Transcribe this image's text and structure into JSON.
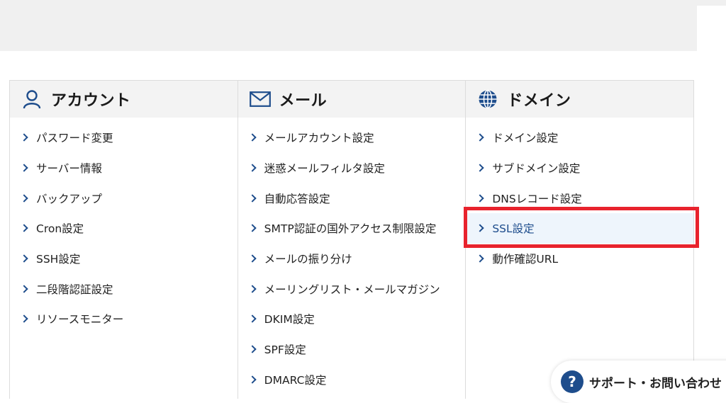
{
  "columns": [
    {
      "title": "アカウント",
      "icon": "user-icon",
      "items": [
        {
          "label": "パスワード変更"
        },
        {
          "label": "サーバー情報"
        },
        {
          "label": "バックアップ"
        },
        {
          "label": "Cron設定"
        },
        {
          "label": "SSH設定"
        },
        {
          "label": "二段階認証設定"
        },
        {
          "label": "リソースモニター"
        }
      ]
    },
    {
      "title": "メール",
      "icon": "mail-icon",
      "items": [
        {
          "label": "メールアカウント設定"
        },
        {
          "label": "迷惑メールフィルタ設定"
        },
        {
          "label": "自動応答設定"
        },
        {
          "label": "SMTP認証の国外アクセス制限設定"
        },
        {
          "label": "メールの振り分け"
        },
        {
          "label": "メーリングリスト・メールマガジン"
        },
        {
          "label": "DKIM設定"
        },
        {
          "label": "SPF設定"
        },
        {
          "label": "DMARC設定"
        }
      ]
    },
    {
      "title": "ドメイン",
      "icon": "globe-icon",
      "items": [
        {
          "label": "ドメイン設定"
        },
        {
          "label": "サブドメイン設定"
        },
        {
          "label": "DNSレコード設定"
        },
        {
          "label": "SSL設定",
          "selected": true
        },
        {
          "label": "動作確認URL"
        }
      ]
    }
  ],
  "support": {
    "icon": "question-icon",
    "label": "サポート・お問い合わせ"
  },
  "colors": {
    "accent": "#1e4d8c",
    "highlight": "#e8232d",
    "header_bg": "#f3f3f3",
    "selected_bg": "#eef5fc"
  }
}
